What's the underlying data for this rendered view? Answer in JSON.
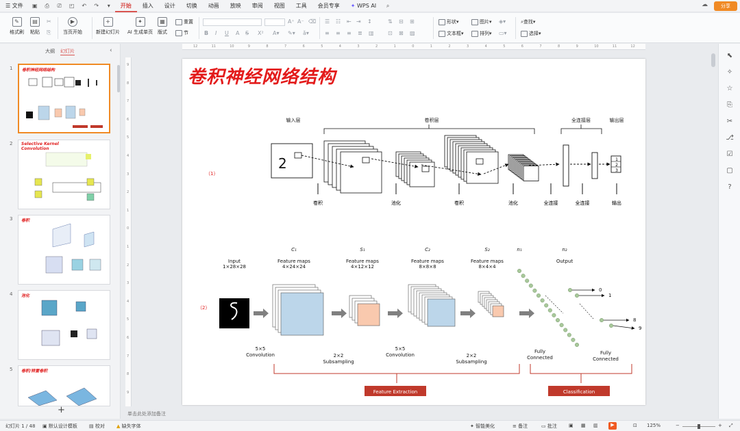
{
  "menu": {
    "file": "文件",
    "items": [
      "开始",
      "插入",
      "设计",
      "切换",
      "动画",
      "放映",
      "审阅",
      "视图",
      "工具",
      "会员专享"
    ],
    "wps_ai": "WPS AI",
    "share": "分享"
  },
  "ribbon": {
    "format_painter": "格式刷",
    "paste": "粘贴",
    "start_from": "当页开始",
    "new_slide": "新建幻灯片",
    "ai_single": "AI 生成单页",
    "layout": "版式",
    "reset": "重置",
    "section": "节",
    "shape": "形状",
    "picture": "图片",
    "textbox": "文本框",
    "arrange": "排列",
    "find": "查找",
    "select": "选择"
  },
  "panel": {
    "tab_outline": "大纲",
    "tab_slides": "幻灯片",
    "add": "+"
  },
  "thumbs": [
    {
      "num": "1",
      "title": "卷积神经网络结构"
    },
    {
      "num": "2",
      "title": "Selective Kernel Convolution"
    },
    {
      "num": "3",
      "title": "卷积"
    },
    {
      "num": "4",
      "title": "池化"
    },
    {
      "num": "5",
      "title": "卷积/转置卷积"
    }
  ],
  "notes_placeholder": "单击此处添加备注",
  "status": {
    "slide_count": "幻灯片 1 / 48",
    "theme": "默认设计模板",
    "proof": "校对",
    "missing_font": "缺失字体",
    "beautify": "智能美化",
    "notes": "备注",
    "comments": "批注",
    "zoom": "125%"
  },
  "slide": {
    "title": "卷积神经网络结构",
    "d1": {
      "label": "（1）",
      "input": "输入层",
      "conv_group": "卷积层",
      "fc_group": "全连接层",
      "output": "输出层",
      "digit": "2",
      "out_nums": [
        "1",
        "2",
        "3"
      ],
      "bottom": [
        "卷积",
        "池化",
        "卷积",
        "池化",
        "全连接",
        "全连接",
        "输出"
      ]
    },
    "d2": {
      "label": "（2）",
      "heads": [
        {
          "sym": "",
          "t1": "Input",
          "t2": "1×28×28"
        },
        {
          "sym": "C₁",
          "t1": "Feature maps",
          "t2": "4×24×24"
        },
        {
          "sym": "S₁",
          "t1": "Feature maps",
          "t2": "4×12×12"
        },
        {
          "sym": "C₂",
          "t1": "Feature maps",
          "t2": "8×8×8"
        },
        {
          "sym": "S₂",
          "t1": "Feature maps",
          "t2": "8×4×4"
        },
        {
          "sym": "n₁",
          "t1": "",
          "t2": ""
        },
        {
          "sym": "n₂",
          "t1": "Output",
          "t2": ""
        }
      ],
      "ops": [
        {
          "a": "5×5",
          "b": "Convolution"
        },
        {
          "a": "2×2",
          "b": "Subsampling"
        },
        {
          "a": "5×5",
          "b": "Convolution"
        },
        {
          "a": "2×2",
          "b": "Subsampling"
        },
        {
          "a": "Fully",
          "b": "Connected"
        },
        {
          "a": "Fully",
          "b": "Connected"
        }
      ],
      "outputs": [
        "0",
        "1",
        "8",
        "9"
      ],
      "feature_extraction": "Feature Extraction",
      "classification": "Classification"
    }
  }
}
